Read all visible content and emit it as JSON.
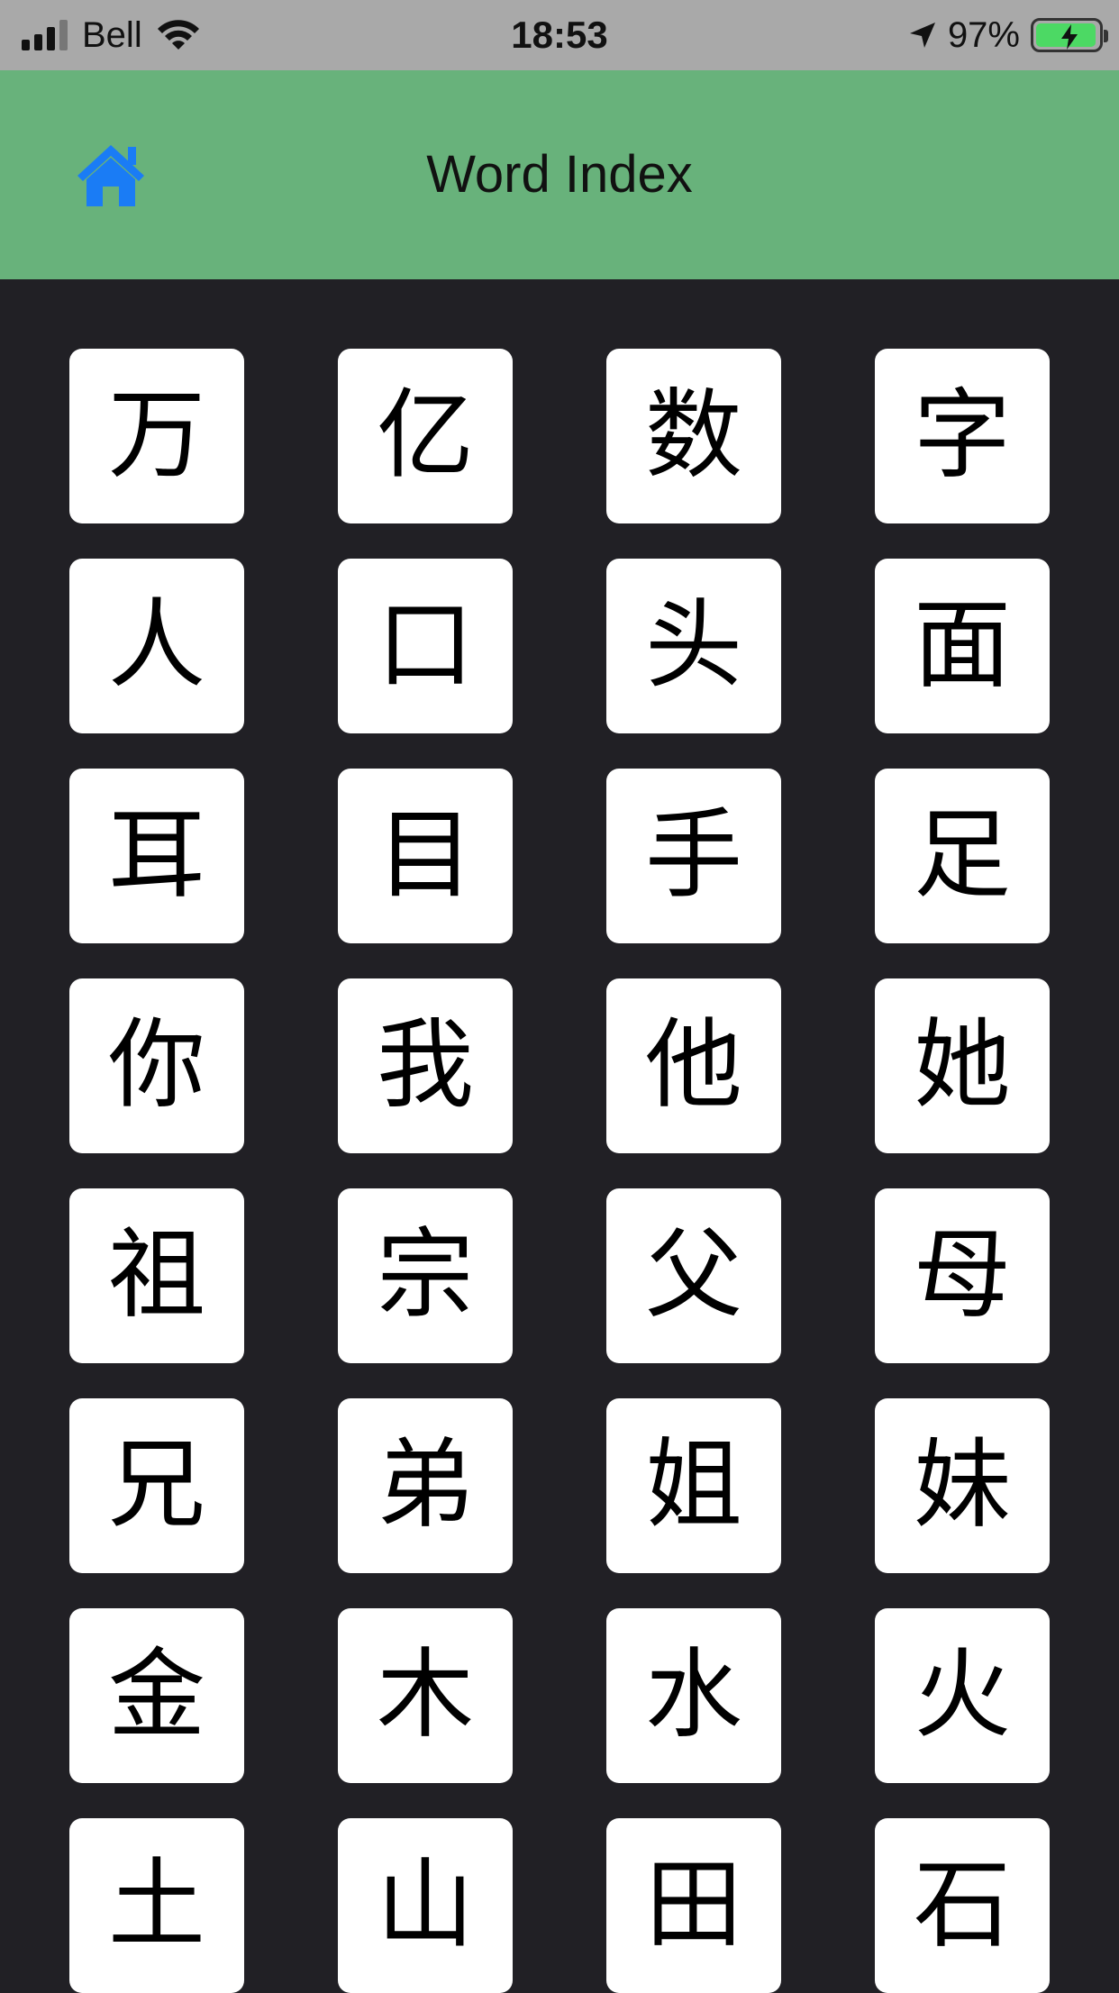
{
  "status_bar": {
    "carrier": "Bell",
    "time": "18:53",
    "battery_percent": "97%",
    "battery_level": 0.97,
    "icons": [
      "signal-icon",
      "wifi-icon",
      "location-icon",
      "battery-icon"
    ]
  },
  "header": {
    "title": "Word Index",
    "home_icon": "home-icon",
    "background": "#68b27b",
    "home_icon_color": "#1a7cf5"
  },
  "characters": [
    "万",
    "亿",
    "数",
    "字",
    "人",
    "口",
    "头",
    "面",
    "耳",
    "目",
    "手",
    "足",
    "你",
    "我",
    "他",
    "她",
    "祖",
    "宗",
    "父",
    "母",
    "兄",
    "弟",
    "姐",
    "妹",
    "金",
    "木",
    "水",
    "火",
    "土",
    "山",
    "田",
    "石"
  ],
  "colors": {
    "background": "#212025",
    "tile": "#ffffff",
    "status_bar": "#a9a9a9"
  }
}
